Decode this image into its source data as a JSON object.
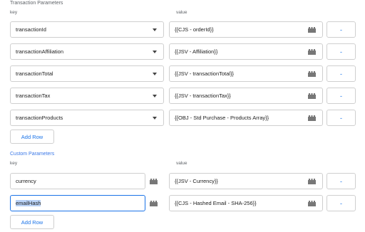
{
  "transaction": {
    "title": "Transaction Parameters",
    "key_label": "key",
    "value_label": "value",
    "rows": [
      {
        "key": "transactionId",
        "value": "{{CJS - orderId}}"
      },
      {
        "key": "transactionAffiliation",
        "value": "{{JSV - Affiliation}}"
      },
      {
        "key": "transactionTotal",
        "value": "{{JSV - transactionTotal}}"
      },
      {
        "key": "transactionTax",
        "value": "{{JSV - transactionTax}}"
      },
      {
        "key": "transactionProducts",
        "value": "{{OBJ - Std Purchase - Products Array}}"
      }
    ],
    "add_row_label": "Add Row"
  },
  "custom": {
    "title": "Custom Parameters",
    "key_label": "key",
    "value_label": "value",
    "rows": [
      {
        "key": "currency",
        "value": "{{JSV - Currency}}"
      },
      {
        "key": "emailHash",
        "value": "{{CJS - Hashed Email - SHA-256}}"
      }
    ],
    "add_row_label": "Add Row"
  },
  "remove_label": "-",
  "icons": {
    "dropdown": "chevron-down-icon",
    "variable": "variable-brick-icon"
  },
  "colors": {
    "accent": "#1a73e8",
    "selection": "#b9d2f7"
  }
}
